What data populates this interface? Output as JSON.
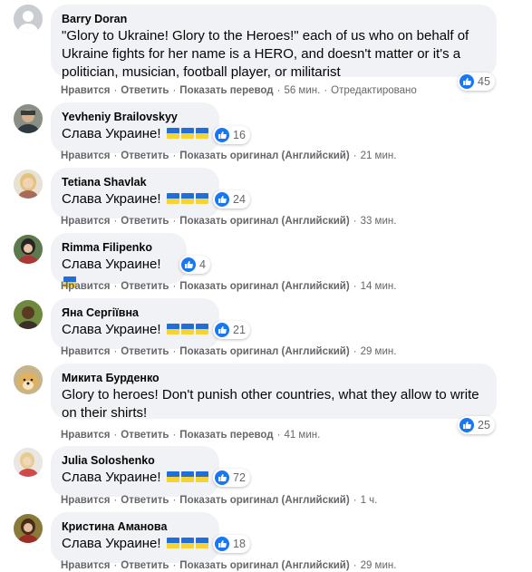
{
  "comments": [
    {
      "author": "Barry Doran",
      "text": "\"Glory to Ukraine! Glory to the Heroes!\" each of us who on behalf of Ukraine fights for her name is a HERO, and doesn't matter or it's a politician, musician, football player, or militarist",
      "likes": "45",
      "like_label": "Нравится",
      "reply_label": "Ответить",
      "translate_label": "Показать перевод",
      "time": "56 мин.",
      "edited": "Отредактировано",
      "avatar": "default-avatar"
    },
    {
      "author": "Yevheniy Brailovskyy",
      "text": "Слава Украине!",
      "flags": 3,
      "likes": "16",
      "like_label": "Нравится",
      "reply_label": "Ответить",
      "translate_label": "Показать оригинал (Английский)",
      "time": "21 мин."
    },
    {
      "author": "Tetiana Shavlak",
      "text": "Слава Украине!",
      "flags": 3,
      "likes": "24",
      "like_label": "Нравится",
      "reply_label": "Ответить",
      "translate_label": "Показать оригинал (Английский)",
      "time": "33 мин."
    },
    {
      "author": "Rimma Filipenko",
      "text": "Слава Украине!",
      "flags": 1,
      "likes": "4",
      "like_label": "Нравится",
      "reply_label": "Ответить",
      "translate_label": "Показать оригинал (Английский)",
      "time": "14 мин."
    },
    {
      "author": "Яна Сергіївна",
      "text": "Слава Украине!",
      "flags": 3,
      "likes": "21",
      "like_label": "Нравится",
      "reply_label": "Ответить",
      "translate_label": "Показать оригинал (Английский)",
      "time": "29 мин."
    },
    {
      "author": "Микита Бурденко",
      "text": "Glory to heroes! Don't punish other countries, what they allow to write on their shirts!",
      "likes": "25",
      "like_label": "Нравится",
      "reply_label": "Ответить",
      "translate_label": "Показать перевод",
      "time": "41 мин."
    },
    {
      "author": "Julia Soloshenko",
      "text": "Слава Украине!",
      "flags": 3,
      "likes": "72",
      "like_label": "Нравится",
      "reply_label": "Ответить",
      "translate_label": "Показать оригинал (Английский)",
      "time": "1 ч."
    },
    {
      "author": "Кристина Аманова",
      "text": "Слава Украине!",
      "flags": 3,
      "likes": "18",
      "like_label": "Нравится",
      "reply_label": "Ответить",
      "translate_label": "Показать оригинал (Английский)",
      "time": "29 мин."
    }
  ],
  "colors": {
    "bubble": "#f0f2f5",
    "like_blue": "#1877f2",
    "meta_gray": "#65676b",
    "flag_blue": "#1f6fd6",
    "flag_yellow": "#f7d331"
  }
}
